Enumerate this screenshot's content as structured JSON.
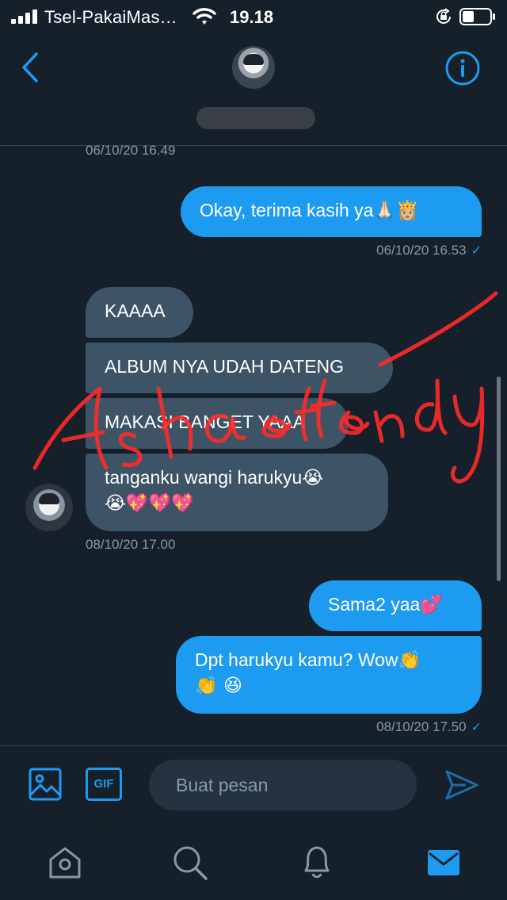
{
  "status_bar": {
    "carrier": "Tsel-PakaiMas…",
    "time": "19.18"
  },
  "header": {
    "back_icon": "chevron-left-icon",
    "info_icon": "info-icon"
  },
  "messages": {
    "ts_top": "06/10/20 16.49",
    "out1": {
      "text": "Okay, terima kasih ya",
      "emoji": "🙏🏻👸🏼"
    },
    "ts_out1": "06/10/20 16.53",
    "in1": "KAAAA",
    "in2": "ALBUM NYA UDAH DATENG",
    "in3": "MAKASI BANGET YAAA",
    "in4_line1": "tanganku wangi harukyu😭",
    "in4_line2": "😭💖💖💖",
    "ts_in": "08/10/20 17.00",
    "out2": "Sama2 yaa💕",
    "out3_line1": "Dpt harukyu kamu? Wow👏",
    "out3_line2": "👏 😆",
    "ts_out3": "08/10/20 17.50"
  },
  "watermark": "Ashaeffendy",
  "composer": {
    "gif_label": "GIF",
    "placeholder": "Buat pesan"
  },
  "colors": {
    "background": "#15202b",
    "outgoing_bubble": "#1d9bf0",
    "incoming_bubble": "#3d5466",
    "accent": "#1d9bf0",
    "watermark": "#ff2a2a"
  }
}
